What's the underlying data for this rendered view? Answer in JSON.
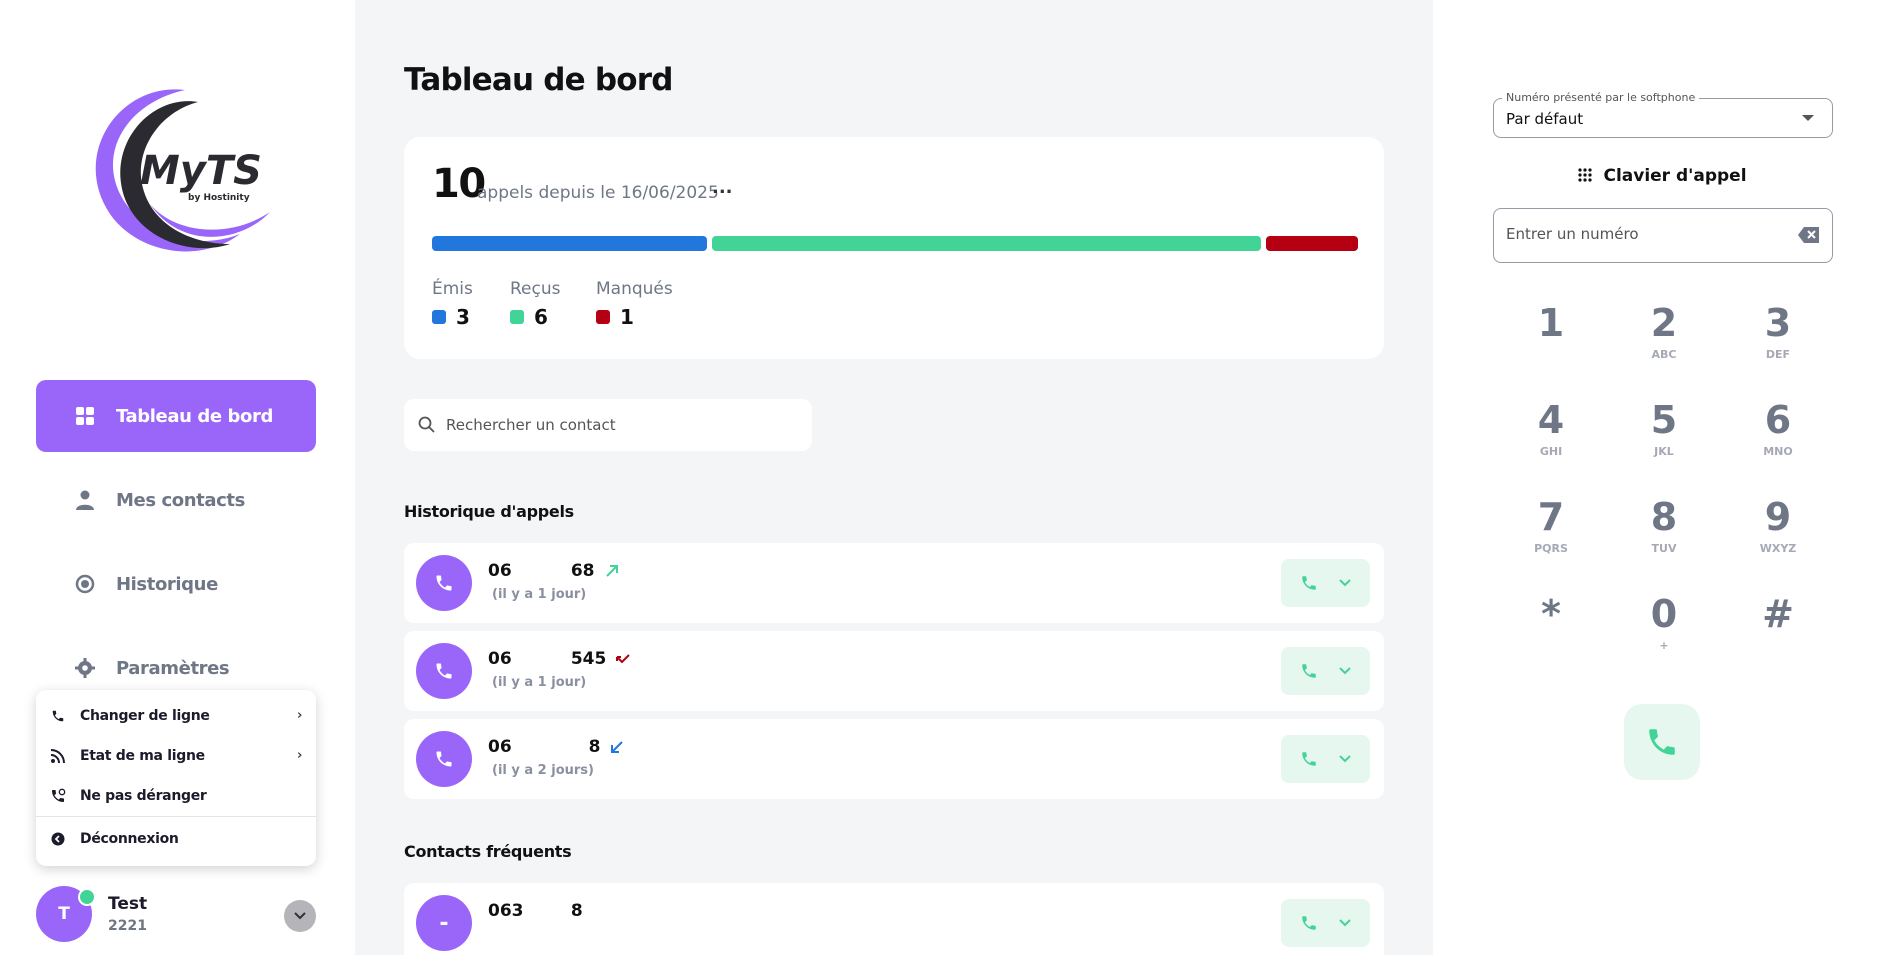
{
  "colors": {
    "accent": "#9a66f9",
    "emitted": "#2277dd",
    "received": "#42d497",
    "missed": "#b50014",
    "call_green": "#42d497"
  },
  "sidebar": {
    "logo_text": "MyTS",
    "logo_sub": "by Hostinity",
    "nav": [
      {
        "label": "Tableau de bord",
        "icon": "grid-icon",
        "active": true
      },
      {
        "label": "Mes contacts",
        "icon": "person-icon",
        "active": false
      },
      {
        "label": "Historique",
        "icon": "history-icon",
        "active": false
      },
      {
        "label": "Paramètres",
        "icon": "gear-icon",
        "active": false
      }
    ],
    "user_menu": [
      {
        "label": "Changer de ligne",
        "icon": "phone-icon",
        "has_submenu": true
      },
      {
        "label": "Etat de ma ligne",
        "icon": "signal-icon",
        "has_submenu": true
      },
      {
        "label": "Ne pas déranger",
        "icon": "do-not-disturb-icon",
        "has_submenu": false
      },
      {
        "label": "Déconnexion",
        "icon": "logout-icon",
        "has_submenu": false
      }
    ],
    "user": {
      "initial": "T",
      "name": "Test",
      "extension": "2221",
      "status": "online"
    }
  },
  "main": {
    "title": "Tableau de bord",
    "stats": {
      "total": "10",
      "since_text": "appels depuis le 16/06/2025",
      "more": "...",
      "emitted": {
        "label": "Émis",
        "value": "3"
      },
      "received": {
        "label": "Reçus",
        "value": "6"
      },
      "missed": {
        "label": "Manqués",
        "value": "1"
      }
    },
    "search": {
      "placeholder": "Rechercher un contact"
    },
    "history_title": "Historique d'appels",
    "history": [
      {
        "number": "06          68",
        "time": "(il y a 1 jour)",
        "direction": "outgoing"
      },
      {
        "number": "06          545",
        "time": "(il y a 1 jour)",
        "direction": "missed"
      },
      {
        "number": "06             8",
        "time": "(il y a 2 jours)",
        "direction": "incoming"
      }
    ],
    "frequent_title": "Contacts fréquents",
    "frequent": [
      {
        "initial": "-",
        "number": "063        8"
      }
    ]
  },
  "right": {
    "softphone_label": "Numéro présenté par le softphone",
    "softphone_value": "Par défaut",
    "keypad_title": "Clavier d'appel",
    "number_placeholder": "Entrer un numéro",
    "keys": [
      {
        "digit": "1",
        "letters": ""
      },
      {
        "digit": "2",
        "letters": "ABC"
      },
      {
        "digit": "3",
        "letters": "DEF"
      },
      {
        "digit": "4",
        "letters": "GHI"
      },
      {
        "digit": "5",
        "letters": "JKL"
      },
      {
        "digit": "6",
        "letters": "MNO"
      },
      {
        "digit": "7",
        "letters": "PQRS"
      },
      {
        "digit": "8",
        "letters": "TUV"
      },
      {
        "digit": "9",
        "letters": "WXYZ"
      },
      {
        "digit": "*",
        "letters": ""
      },
      {
        "digit": "0",
        "letters": "+"
      },
      {
        "digit": "#",
        "letters": ""
      }
    ]
  }
}
